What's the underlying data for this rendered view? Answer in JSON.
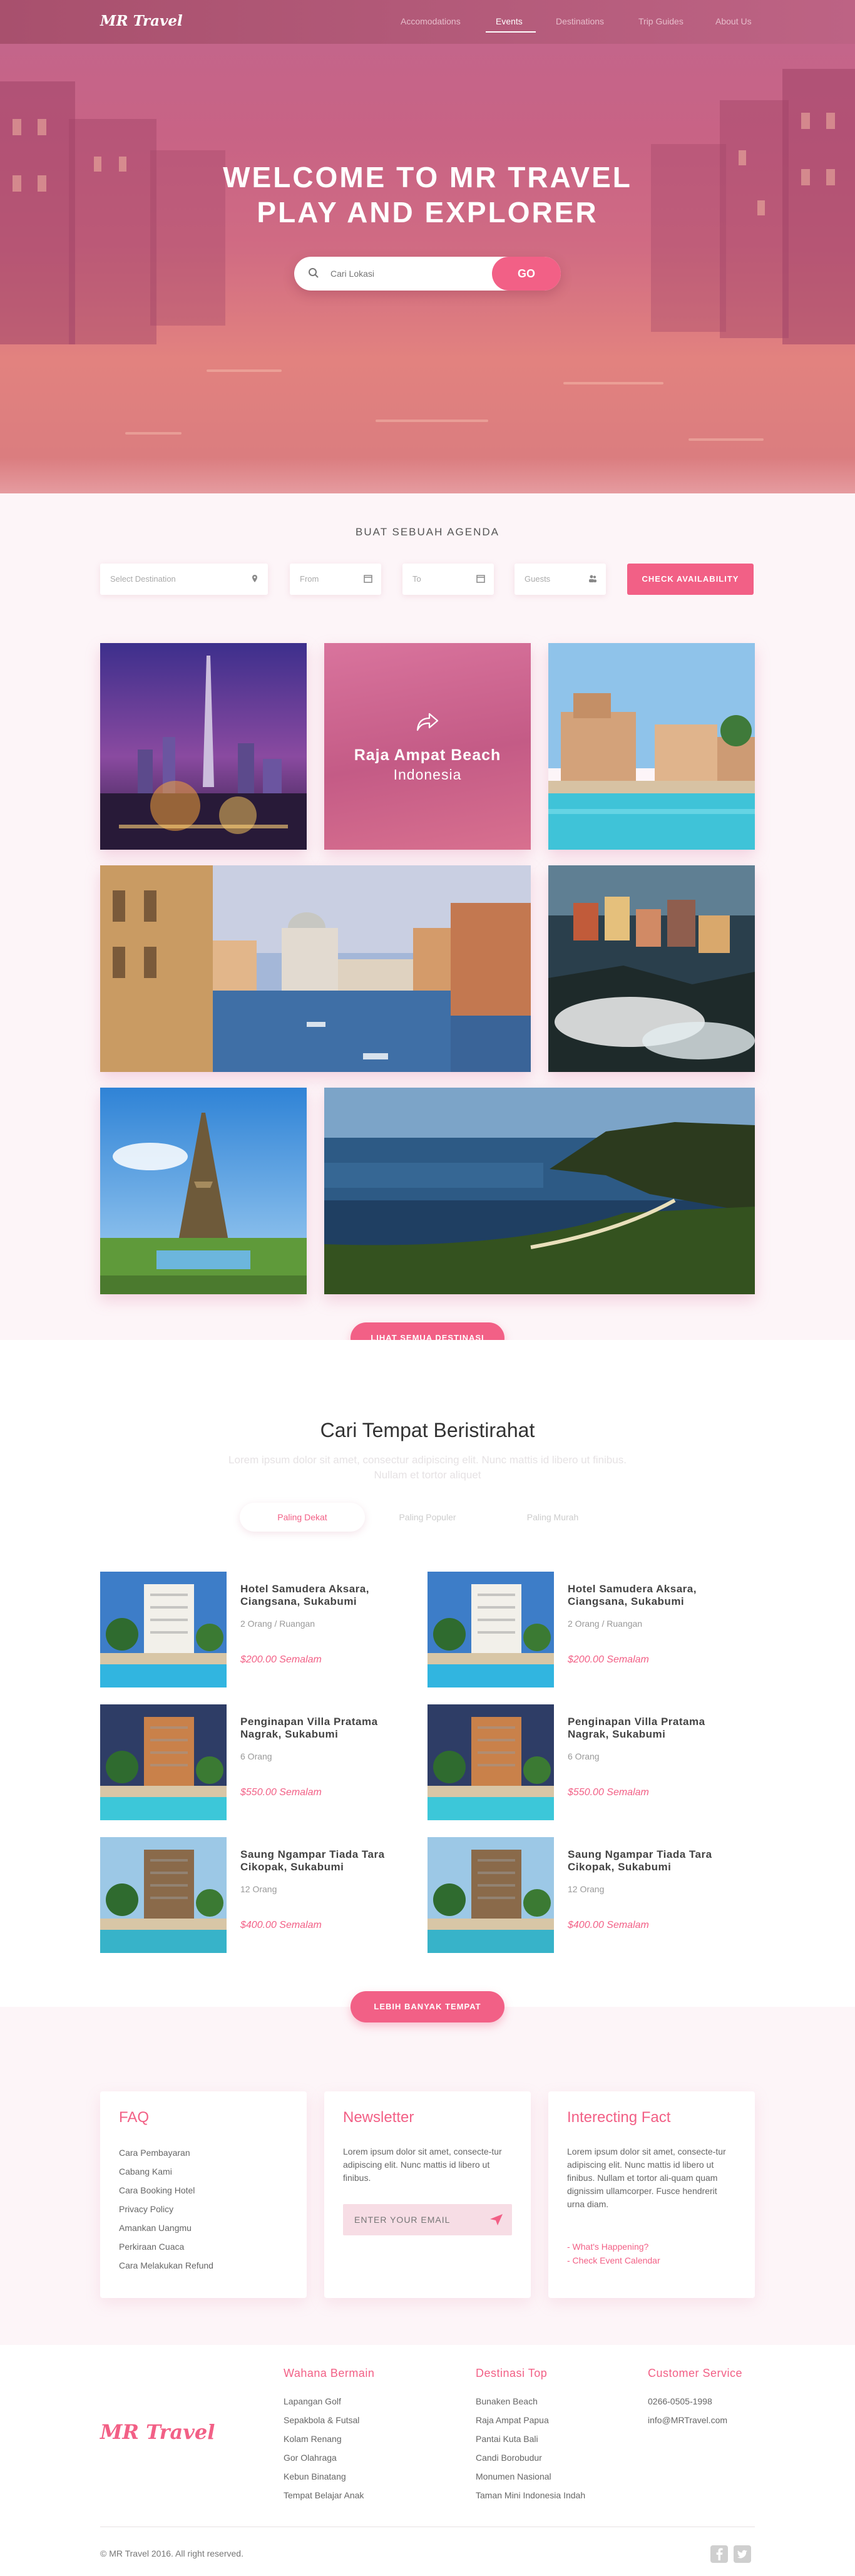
{
  "nav": {
    "logo": "MR Travel",
    "links": [
      "Accomodations",
      "Events",
      "Destinations",
      "Trip Guides",
      "About Us"
    ],
    "active_index": 1
  },
  "hero": {
    "title_line1": "WELCOME TO MR TRAVEL",
    "title_line2": "PLAY AND EXPLORER",
    "search_placeholder": "Cari Lokasi",
    "go_label": "GO"
  },
  "agenda": {
    "title": "BUAT SEBUAH AGENDA",
    "destination_placeholder": "Select Destination",
    "from_label": "From",
    "to_label": "To",
    "guests_label": "Guests",
    "check_label": "CHECK AVAILABILITY"
  },
  "gallery": {
    "featured_name": "Raja Ampat Beach",
    "featured_sub": "Indonesia",
    "more_label": "LIHAT SEMUA DESTINASI"
  },
  "rest": {
    "title": "Cari Tempat Beristirahat",
    "subtitle": "Lorem ipsum dolor sit amet, consectur adipiscing elit. Nunc mattis id libero ut finibus. Nullam et tortor aliquet",
    "tabs": [
      "Paling Dekat",
      "Paling Populer",
      "Paling Murah"
    ],
    "hotels": [
      {
        "name": "Hotel Samudera Aksara, Ciangsana, Sukabumi",
        "meta": "2 Orang / Ruangan",
        "price": "$200.00 Semalam"
      },
      {
        "name": "Hotel Samudera Aksara, Ciangsana, Sukabumi",
        "meta": "2 Orang / Ruangan",
        "price": "$200.00 Semalam"
      },
      {
        "name": "Penginapan Villa Pratama Nagrak, Sukabumi",
        "meta": "6 Orang",
        "price": "$550.00 Semalam"
      },
      {
        "name": "Penginapan Villa Pratama Nagrak, Sukabumi",
        "meta": "6 Orang",
        "price": "$550.00 Semalam"
      },
      {
        "name": "Saung Ngampar Tiada Tara Cikopak, Sukabumi",
        "meta": "12 Orang",
        "price": "$400.00 Semalam"
      },
      {
        "name": "Saung Ngampar Tiada Tara Cikopak, Sukabumi",
        "meta": "12 Orang",
        "price": "$400.00 Semalam"
      }
    ],
    "more_label": "LEBIH BANYAK TEMPAT"
  },
  "cards": {
    "faq_title": "FAQ",
    "faq_items": [
      "Cara Pembayaran",
      "Cabang Kami",
      "Cara Booking Hotel",
      "Privacy Policy",
      "Amankan Uangmu",
      "Perkiraan Cuaca",
      "Cara Melakukan Refund"
    ],
    "newsletter_title": "Newsletter",
    "newsletter_text": "Lorem ipsum dolor sit amet, consecte-tur adipiscing elit. Nunc mattis id libero ut finibus.",
    "email_placeholder": "ENTER YOUR EMAIL",
    "fact_title": "Interecting Fact",
    "fact_text": "Lorem ipsum dolor sit amet, consecte-tur adipiscing elit. Nunc mattis id libero ut finibus. Nullam et tortor ali-quam quam dignissim ullamcorper. Fusce hendrerit urna diam.",
    "fact_links": [
      "- What's Happening?",
      "- Check Event Calendar"
    ]
  },
  "footer": {
    "logo": "MR Travel",
    "col1_title": "Wahana Bermain",
    "col1_items": [
      "Lapangan Golf",
      "Sepakbola & Futsal",
      "Kolam Renang",
      "Gor Olahraga",
      "Kebun Binatang",
      "Tempat Belajar Anak"
    ],
    "col2_title": "Destinasi Top",
    "col2_items": [
      "Bunaken Beach",
      "Raja Ampat Papua",
      "Pantai Kuta Bali",
      "Candi Borobudur",
      "Monumen Nasional",
      "Taman Mini Indonesia Indah"
    ],
    "col3_title": "Customer Service",
    "col3_items": [
      "0266-0505-1998",
      "info@MRTravel.com"
    ],
    "copyright": "© MR Travel 2016. All right reserved."
  },
  "colors": {
    "accent": "#f26086",
    "nav": "#b05a78",
    "featured": "#cf6992"
  },
  "icons": [
    "search-icon",
    "location-pin-icon",
    "calendar-icon",
    "guests-icon",
    "share-icon",
    "send-icon",
    "facebook-icon",
    "twitter-icon"
  ]
}
